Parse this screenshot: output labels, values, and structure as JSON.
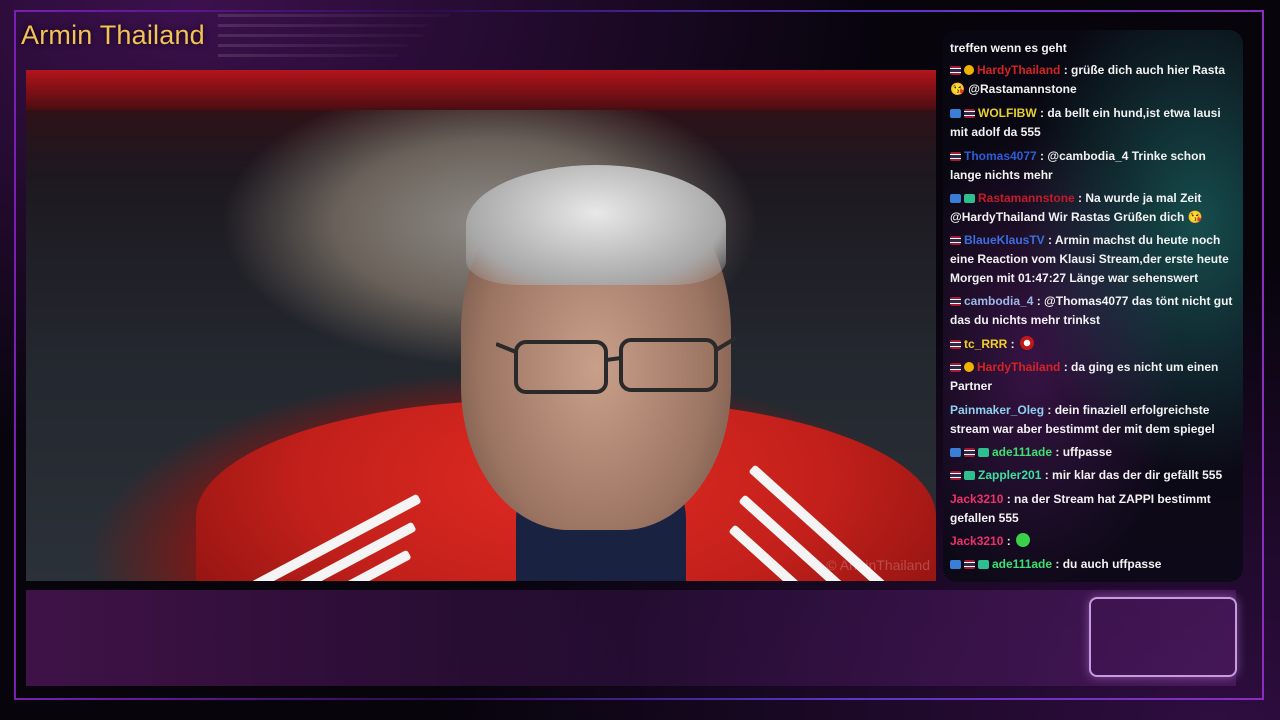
{
  "header": {
    "streamer_name": "Armin Thailand"
  },
  "webcam": {
    "watermark": "© ArminThailand"
  },
  "colors": {
    "streamer_name": "#f2c25a",
    "chat_text": "#f2f2f2"
  },
  "chat": {
    "messages": [
      {
        "user": "",
        "text": "treffen wenn es geht",
        "user_color": "#f2f2f2"
      },
      {
        "user": "HardyThailand",
        "text": " : grüße dich auch hier Rasta 😘 @Rastamannstone",
        "user_color": "#d62424"
      },
      {
        "user": "WOLFIBW",
        "text": " : da bellt ein hund,ist etwa lausi mit adolf da 555",
        "user_color": "#e7d02c"
      },
      {
        "user": "Thomas4077",
        "text": " : @cambodia_4 Trinke schon lange nichts mehr",
        "user_color": "#2f5cd9"
      },
      {
        "user": "Rastamannstone",
        "text": " : Na wurde ja mal Zeit @HardyThailand Wir Rastas Grüßen dich 😘",
        "user_color": "#c41a2a"
      },
      {
        "user": "BlaueKlausTV",
        "text": " : Armin machst du heute noch eine Reaction vom Klausi Stream,der erste heute Morgen mit 01:47:27 Länge war sehenswert",
        "user_color": "#3b6ee0"
      },
      {
        "user": "cambodia_4",
        "text": " : @Thomas4077 das tönt nicht gut das du nichts mehr trinkst",
        "user_color": "#9fb9e8"
      },
      {
        "user": "tc_RRR",
        "text": " : ",
        "user_color": "#f0d020"
      },
      {
        "user": "HardyThailand",
        "text": " : da ging es nicht um einen Partner",
        "user_color": "#d62424"
      },
      {
        "user": "Painmaker_Oleg",
        "text": " : dein finaziell erfolgreichste stream war aber bestimmt der mit dem spiegel",
        "user_color": "#8fd0f0"
      },
      {
        "user": "ade111ade",
        "text": " : uffpasse",
        "user_color": "#3ee070"
      },
      {
        "user": "Zappler201",
        "text": " : mir klar das der dir gefällt 555",
        "user_color": "#3ee0a0"
      },
      {
        "user": "Jack3210",
        "text": " : na der Stream hat ZAPPI bestimmt gefallen 555",
        "user_color": "#f0306a"
      },
      {
        "user": "Jack3210",
        "text": " : ",
        "user_color": "#f0306a"
      },
      {
        "user": "ade111ade",
        "text": " : du auch uffpasse",
        "user_color": "#3ee070"
      }
    ]
  }
}
